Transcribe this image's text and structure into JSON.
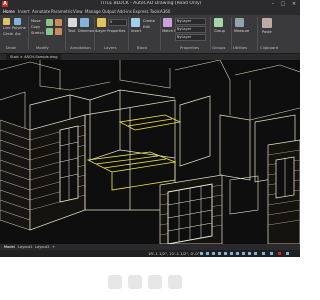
{
  "window": {
    "title": "TITLE BLOCK - AutoCAD Drawing (Read Only)"
  },
  "ribbon_tabs": [
    {
      "label": "Home"
    },
    {
      "label": "Insert"
    },
    {
      "label": "Annotate"
    },
    {
      "label": "Parametric"
    },
    {
      "label": "View"
    },
    {
      "label": "Manage"
    },
    {
      "label": "Output"
    },
    {
      "label": "Add-ins"
    },
    {
      "label": "Express Tools"
    },
    {
      "label": "A360"
    }
  ],
  "ribbon": {
    "panels": [
      {
        "label": "Draw"
      },
      {
        "label": "Modify"
      },
      {
        "label": "Annotation"
      },
      {
        "label": "Layers"
      },
      {
        "label": "Block"
      },
      {
        "label": "Properties"
      },
      {
        "label": "Groups"
      },
      {
        "label": "Utilities"
      },
      {
        "label": "Clipboard"
      }
    ],
    "buttons": {
      "line": "Line",
      "polyline": "Polyline",
      "circle": "Circle",
      "arc": "Arc",
      "move": "Move",
      "copy": "Copy",
      "stretch": "Stretch",
      "text": "Text",
      "dimension": "Dimension",
      "layer_props": "Layer Properties",
      "insert": "Insert",
      "create": "Create",
      "edit": "Edit",
      "match": "Match Properties",
      "group": "Group",
      "measure": "Measure",
      "paste": "Paste"
    },
    "selects": {
      "layer": "0",
      "color": "ByLayer",
      "linetype": "ByLayer",
      "lineweight": "ByLayer"
    }
  },
  "doc_tab": {
    "label": "Start  ×  ARCH-Sample.dwg"
  },
  "layout_tabs": [
    {
      "label": "Model"
    },
    {
      "label": "Layout1"
    },
    {
      "label": "Layout2"
    },
    {
      "label": "+"
    }
  ],
  "status": {
    "coords": "1R'-1 1/2\", 21'-1 1/2\", 0'-0\""
  },
  "colors": {
    "accent": "#c62828",
    "canvas": "#0e0e0e",
    "ribbon": "#3a3a3c",
    "wall": "#e8e2c8",
    "highlight": "#f2ea4a"
  }
}
